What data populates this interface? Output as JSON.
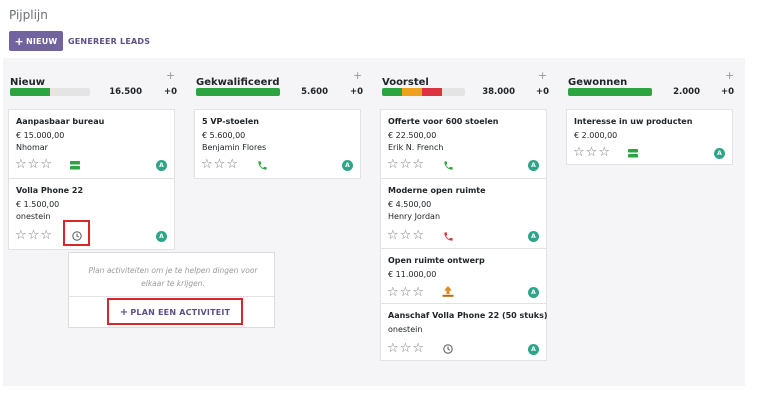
{
  "page": {
    "title": "Pijplijn"
  },
  "toolbar": {
    "new_label": "NIEUW",
    "generate_label": "GENEREER LEADS"
  },
  "colors": {
    "green": "#2ca43f",
    "orange": "#f1a01d",
    "red": "#dd3341",
    "grey": "#e4e4e4",
    "brand": "#71639e",
    "avatar": "#2ea587"
  },
  "columns": [
    {
      "title": "Nieuw",
      "total": "16.500",
      "delta": "+0",
      "progress": [
        {
          "color": "green",
          "fraction": 0.5
        }
      ],
      "cards": [
        {
          "title": "Aanpasbaar bureau",
          "amount": "€ 15.000,00",
          "contact": "Nhomar",
          "activity": "list-icon",
          "avatar": "A"
        },
        {
          "title": "Volla Phone 22",
          "amount": "€ 1.500,00",
          "contact": "onestein",
          "activity": "clock-icon",
          "avatar": "A"
        }
      ]
    },
    {
      "title": "Gekwalificeerd",
      "total": "5.600",
      "delta": "+0",
      "progress": [
        {
          "color": "green",
          "fraction": 1.0
        }
      ],
      "cards": [
        {
          "title": "5 VP-stoelen",
          "amount": "€ 5.600,00",
          "contact": "Benjamin Flores",
          "activity": "phone-icon",
          "avatar": "A"
        }
      ]
    },
    {
      "title": "Voorstel",
      "total": "38.000",
      "delta": "+0",
      "progress": [
        {
          "color": "green",
          "fraction": 0.24
        },
        {
          "color": "orange",
          "fraction": 0.24
        },
        {
          "color": "red",
          "fraction": 0.24
        }
      ],
      "cards": [
        {
          "title": "Offerte voor 600 stoelen",
          "amount": "€ 22.500,00",
          "contact": "Erik N. French",
          "activity": "phone-icon",
          "avatar": "A"
        },
        {
          "title": "Moderne open ruimte",
          "amount": "€ 4.500,00",
          "contact": "Henry Jordan",
          "activity": "phone-red-icon",
          "avatar": "A"
        },
        {
          "title": "Open ruimte ontwerp",
          "amount": "€ 11.000,00",
          "contact": "",
          "activity": "upload-icon",
          "avatar": "A"
        },
        {
          "title": "Aanschaf Volla Phone 22 (50 stuks)",
          "amount": "",
          "contact": "onestein",
          "activity": "clock-icon",
          "avatar": "A"
        }
      ]
    },
    {
      "title": "Gewonnen",
      "total": "2.000",
      "delta": "+0",
      "progress": [
        {
          "color": "green",
          "fraction": 1.0
        }
      ],
      "cards": [
        {
          "title": "Interesse in uw producten",
          "amount": "€ 2.000,00",
          "contact": "",
          "activity": "list-icon",
          "avatar": "A"
        }
      ]
    }
  ],
  "popover": {
    "text": "Plan activiteiten om je te helpen dingen voor elkaar te krijgen.",
    "button_label": "PLAN EEN ACTIVITEIT"
  }
}
